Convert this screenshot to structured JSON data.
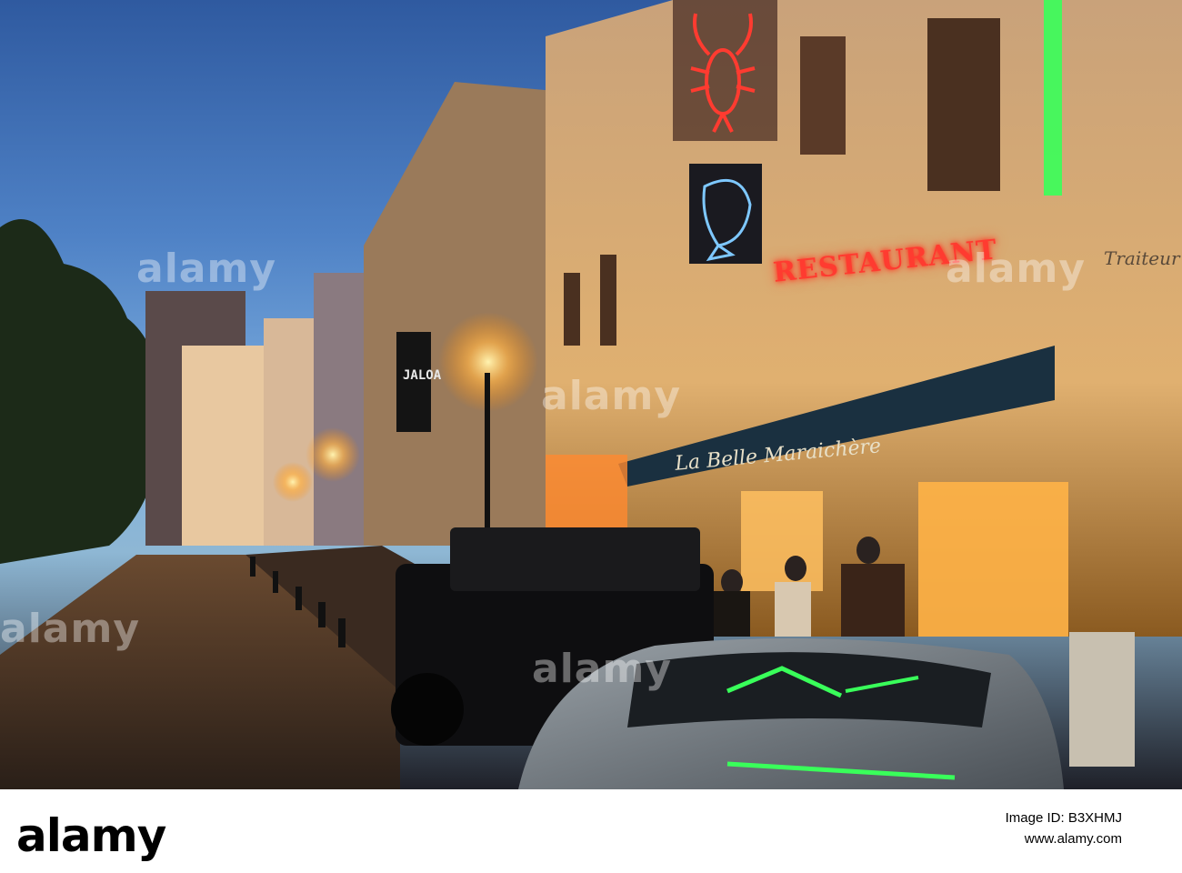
{
  "photo": {
    "description_colors": {
      "sky": "#4f82c6",
      "neon_red": "#ff3b30",
      "neon_green": "#39ff5a",
      "street_glow": "#ffb347"
    },
    "signs": {
      "restaurant": "RESTAURANT",
      "awning": "La Belle Maraichère",
      "traiteur": "Traiteur",
      "jaloa": "JALOA"
    },
    "watermarks": [
      "alamy",
      "alamy",
      "alamy",
      "alamy",
      "alamy"
    ]
  },
  "footer": {
    "logo": "alamy",
    "image_id": "Image ID: B3XHMJ",
    "url": "www.alamy.com"
  }
}
